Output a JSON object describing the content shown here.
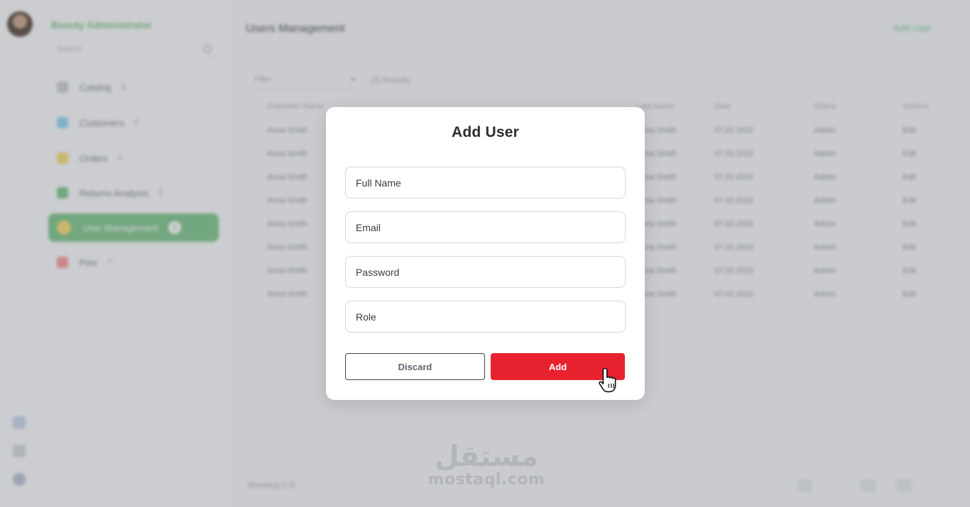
{
  "background_app": {
    "brand": "Beauty Administrator",
    "sidebar_search_placeholder": "Search",
    "nav_items": [
      {
        "label": "Catalog",
        "count": "2",
        "color": "#c8cbd0"
      },
      {
        "label": "Customers",
        "count": "3",
        "color": "#8fd3f0"
      },
      {
        "label": "Orders",
        "count": "4",
        "color": "#f3da73"
      },
      {
        "label": "Returns Analysis",
        "count": "5",
        "color": "#7ec48b"
      },
      {
        "label": "User Management",
        "count": "6",
        "color": "#f3da73",
        "active": true
      },
      {
        "label": "Pins",
        "count": "7",
        "color": "#f29a9a"
      }
    ],
    "page_title": "Users Management",
    "top_action": "Add User",
    "filter_placeholder": "Filter",
    "filter_count": "25 Results",
    "table_header": [
      "Customer Name",
      "Last Name",
      "Date",
      "Status",
      "Actions"
    ],
    "table_rows": [
      [
        "Anna Smith",
        "Anna Smith",
        "07.02.2022",
        "Admin",
        "Edit"
      ],
      [
        "Anna Smith",
        "Anna Smith",
        "07.02.2022",
        "Admin",
        "Edit"
      ],
      [
        "Anna Smith",
        "Anna Smith",
        "07.02.2022",
        "Admin",
        "Edit"
      ],
      [
        "Anna Smith",
        "Anna Smith",
        "07.02.2022",
        "Admin",
        "Edit"
      ],
      [
        "Anna Smith",
        "Anna Smith",
        "07.02.2022",
        "Admin",
        "Edit"
      ],
      [
        "Anna Smith",
        "Anna Smith",
        "07.02.2022",
        "Admin",
        "Edit"
      ],
      [
        "Anna Smith",
        "Anna Smith",
        "07.02.2022",
        "Admin",
        "Edit"
      ],
      [
        "Anna Smith",
        "Anna Smith",
        "07.02.2022",
        "Admin",
        "Edit"
      ]
    ],
    "footer_text": "Showing 1-8"
  },
  "modal": {
    "title": "Add User",
    "fields": {
      "full_name": {
        "placeholder": "Full Name",
        "value": ""
      },
      "email": {
        "placeholder": "Email",
        "value": ""
      },
      "password": {
        "placeholder": "Password",
        "value": ""
      },
      "role": {
        "placeholder": "Role",
        "value": ""
      }
    },
    "discard_label": "Discard",
    "add_label": "Add",
    "add_color": "#e8212f"
  },
  "watermark": {
    "arabic": "مستقل",
    "latin": "mostaql.com"
  },
  "cursor_icon": "hand-pointer-icon"
}
